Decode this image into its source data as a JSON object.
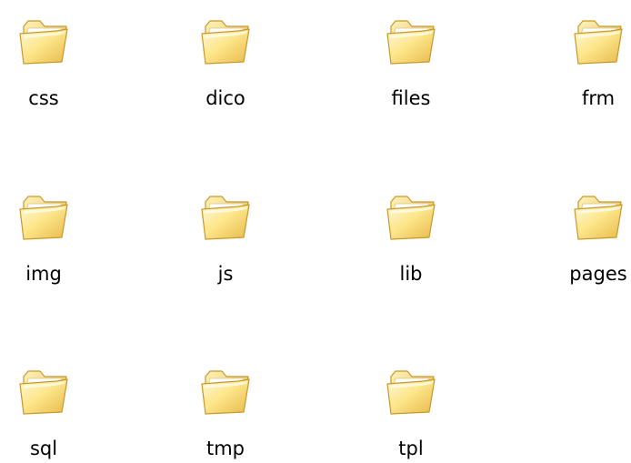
{
  "folder_view": {
    "icon": "folder-icon",
    "colors": {
      "background": "#ffffff",
      "folder_light": "#fff6c8",
      "folder_mid": "#fde68b",
      "folder_dark": "#e7b94a",
      "folder_outline": "#c9982d"
    },
    "items": [
      {
        "name": "css"
      },
      {
        "name": "dico"
      },
      {
        "name": "files"
      },
      {
        "name": "frm"
      },
      {
        "name": "img"
      },
      {
        "name": "js"
      },
      {
        "name": "lib"
      },
      {
        "name": "pages"
      },
      {
        "name": "sql"
      },
      {
        "name": "tmp"
      },
      {
        "name": "tpl"
      }
    ]
  }
}
